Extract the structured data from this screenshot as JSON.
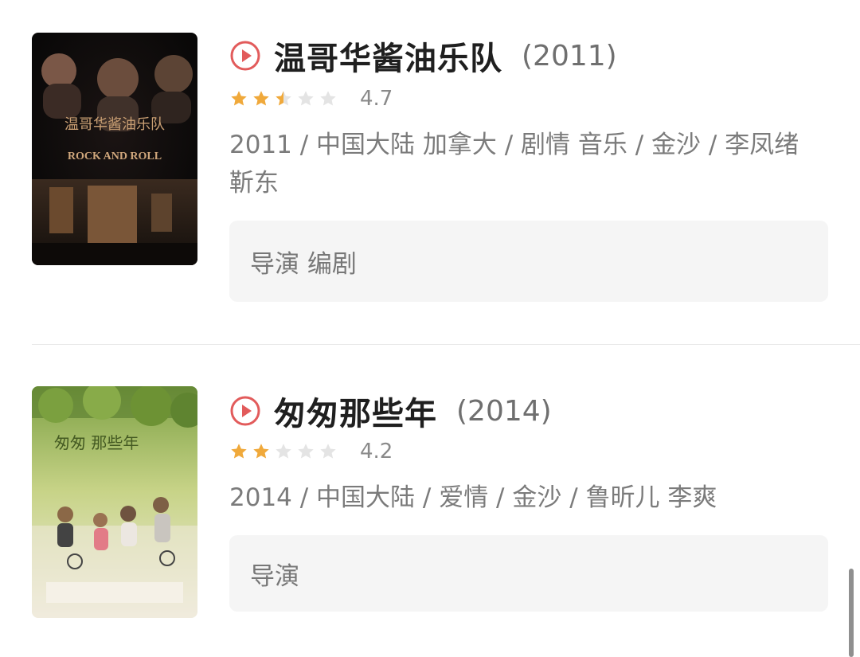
{
  "movies": [
    {
      "title": "温哥华酱油乐队",
      "year": "(2011)",
      "score": "4.7",
      "stars": 2.5,
      "meta": "2011 / 中国大陆 加拿大 / 剧情 音乐 / 金沙 / 李凤绪 靳东",
      "roles": "导演 编剧",
      "poster": {
        "title_text": "温哥华酱油乐队",
        "subtitle_text": "ROCK AND ROLL"
      }
    },
    {
      "title": "匆匆那些年",
      "year": "(2014)",
      "score": "4.2",
      "stars": 2,
      "meta": "2014 / 中国大陆 / 爱情 / 金沙 / 鲁昕儿 李爽",
      "roles": "导演",
      "poster": {
        "title_text": "匆匆 那些年"
      }
    }
  ],
  "colors": {
    "play_icon": "#e25b5b",
    "star_filled": "#f0a93b",
    "star_empty": "#e4e4e4"
  }
}
